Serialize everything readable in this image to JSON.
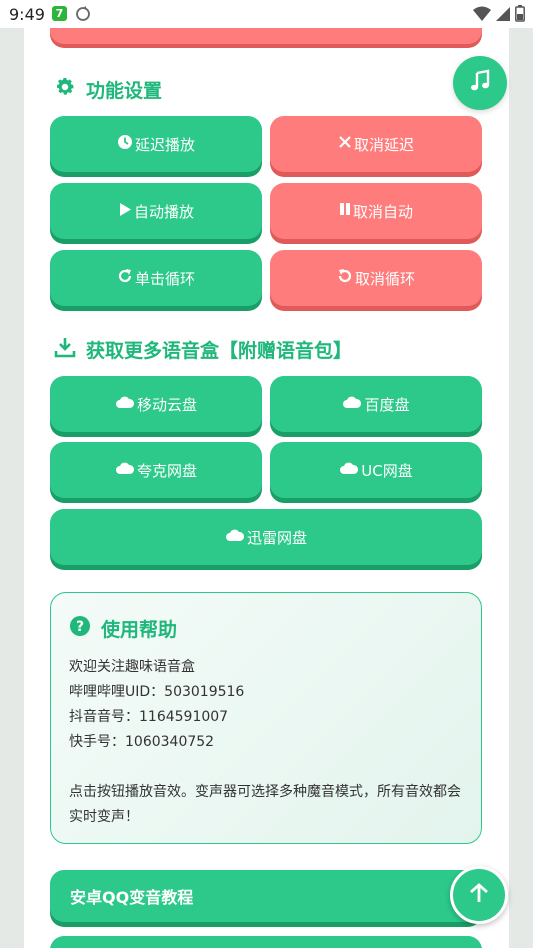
{
  "status_bar": {
    "time": "9:49",
    "badge": "7",
    "icons": [
      "sync-icon",
      "wifi-icon",
      "signal-icon",
      "battery-icon"
    ]
  },
  "function_settings": {
    "title": "功能设置",
    "buttons": [
      {
        "label": "延迟播放",
        "icon": "clock-icon",
        "color": "green"
      },
      {
        "label": "取消延迟",
        "icon": "x-icon",
        "color": "red"
      },
      {
        "label": "自动播放",
        "icon": "play-icon",
        "color": "green"
      },
      {
        "label": "取消自动",
        "icon": "pause-icon",
        "color": "red"
      },
      {
        "label": "单击循环",
        "icon": "repeat-icon",
        "color": "green"
      },
      {
        "label": "取消循环",
        "icon": "undo-icon",
        "color": "red"
      }
    ]
  },
  "downloads": {
    "title": "获取更多语音盒【附赠语音包】",
    "buttons": [
      {
        "label": "移动云盘",
        "icon": "cloud-icon"
      },
      {
        "label": "百度盘",
        "icon": "cloud-icon"
      },
      {
        "label": "夸克网盘",
        "icon": "cloud-icon"
      },
      {
        "label": "UC网盘",
        "icon": "cloud-icon"
      },
      {
        "label": "迅雷网盘",
        "icon": "cloud-icon"
      }
    ]
  },
  "help": {
    "title": "使用帮助",
    "lines": [
      "欢迎关注趣味语音盒",
      "哔哩哔哩UID：503019516",
      "抖音音号：1164591007",
      "快手号：1060340752"
    ],
    "description": "点击按钮播放音效。变声器可选择多种魔音模式，所有音效都会实时变声！"
  },
  "tutorial": {
    "label": "安卓QQ变音教程"
  },
  "colors": {
    "green": "#2cc98a",
    "green_shadow": "#1a9e68",
    "red": "#ff7c7c",
    "red_shadow": "#e05a5a",
    "title": "#1fb77a"
  }
}
